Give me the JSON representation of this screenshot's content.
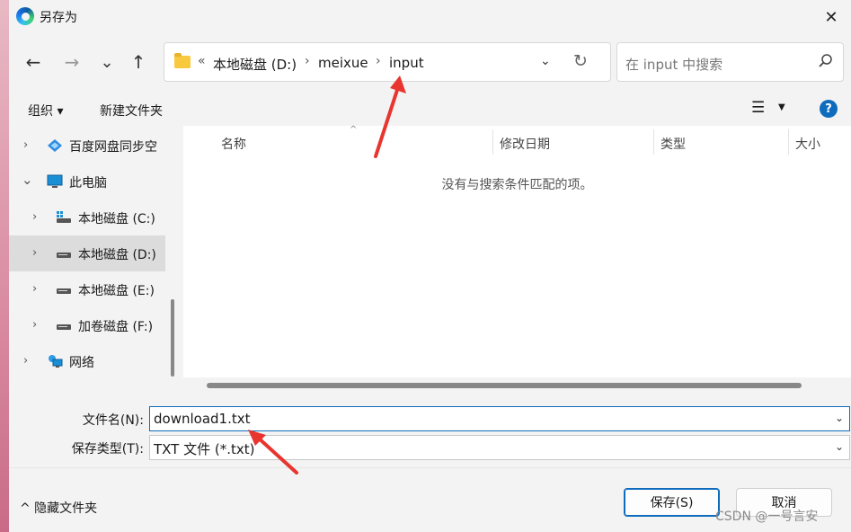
{
  "window": {
    "title": "另存为",
    "close_glyph": "✕"
  },
  "nav": {
    "back": "←",
    "forward": "→",
    "recent": "⌄",
    "up": "↑"
  },
  "address": {
    "overflow": "«",
    "crumbs": [
      "本地磁盘 (D:)",
      "meixue",
      "input"
    ],
    "separator": "›",
    "dropdown": "⌄",
    "refresh": "↻"
  },
  "search": {
    "placeholder": "在 input 中搜索"
  },
  "commands": {
    "organize": "组织 ▾",
    "new_folder": "新建文件夹",
    "view_icon": "☰",
    "view_dd": "▼",
    "help": "?"
  },
  "tree": [
    {
      "label": "百度网盘同步空",
      "chev": "›",
      "icon": "baidu-netdisk-icon"
    },
    {
      "label": "此电脑",
      "chev": "⌄",
      "icon": "computer-icon"
    },
    {
      "label": "本地磁盘 (C:)",
      "chev": "›",
      "icon": "drive-icon"
    },
    {
      "label": "本地磁盘 (D:)",
      "chev": "›",
      "icon": "drive-icon"
    },
    {
      "label": "本地磁盘 (E:)",
      "chev": "›",
      "icon": "drive-icon"
    },
    {
      "label": "加卷磁盘 (F:)",
      "chev": "›",
      "icon": "drive-icon"
    },
    {
      "label": "网络",
      "chev": "›",
      "icon": "network-icon"
    }
  ],
  "columns": {
    "name": "名称",
    "modified": "修改日期",
    "type": "类型",
    "size": "大小",
    "sort_caret": "^"
  },
  "empty_message": "没有与搜索条件匹配的项。",
  "form": {
    "filename_label": "文件名(N):",
    "filename_value": "download1.txt",
    "filetype_label": "保存类型(T):",
    "filetype_value": "TXT 文件 (*.txt)",
    "dd": "⌄"
  },
  "footer": {
    "hide_folders": "^ 隐藏文件夹",
    "save": "保存(S)",
    "cancel": "取消",
    "watermark": "CSDN @一号言安"
  },
  "colors": {
    "accent": "#0f6cbd",
    "annotation_arrow": "#e8352f"
  }
}
